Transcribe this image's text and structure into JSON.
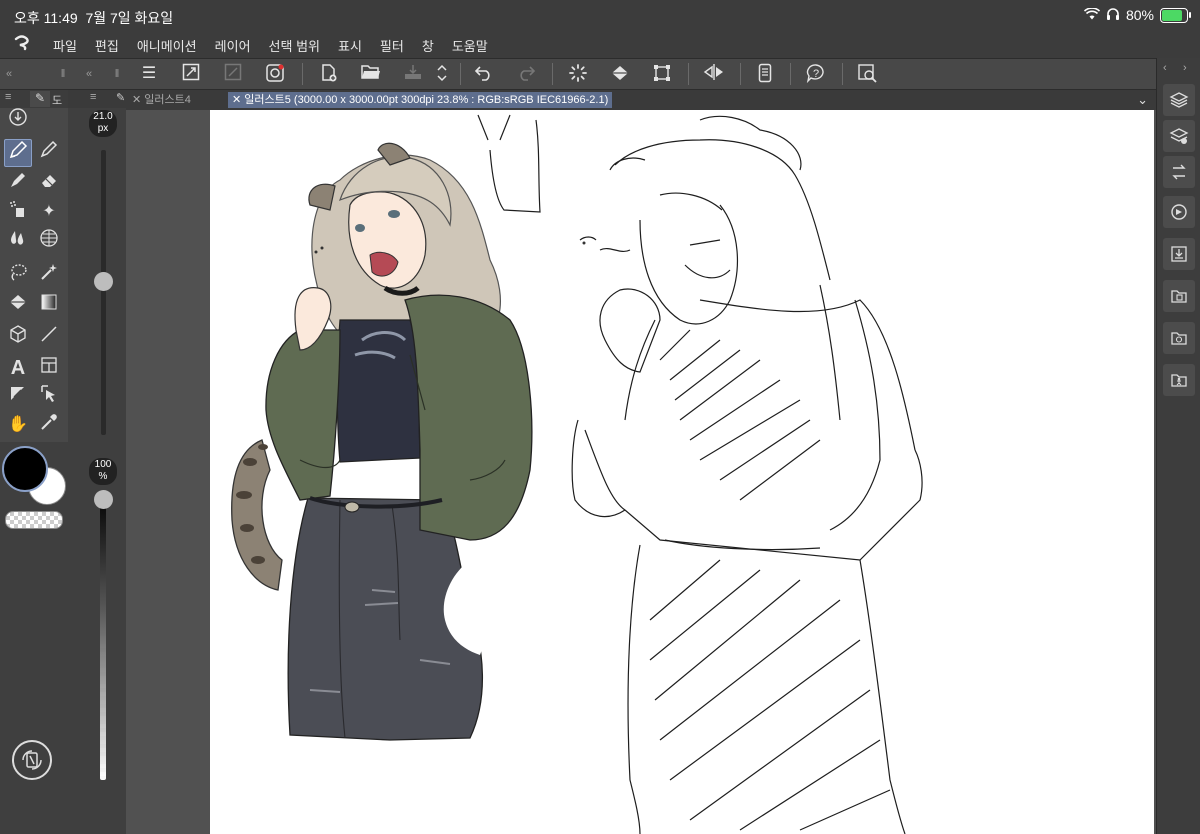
{
  "status": {
    "time": "오후 11:49",
    "date": "7월 7일 화요일",
    "battery": "80%",
    "battery_level": 0.8
  },
  "menu": [
    "파일",
    "편집",
    "애니메이션",
    "레이어",
    "선택 범위",
    "표시",
    "필터",
    "창",
    "도움말"
  ],
  "tabs": [
    {
      "label": "일러스트4",
      "active": false
    },
    {
      "label": "일러스트5 (3000.00 x 3000.00pt 300dpi 23.8% : RGB:sRGB IEC61966-2.1)",
      "active": true
    }
  ],
  "brush": {
    "size": "21.0",
    "size_unit": "px",
    "size_fraction": 0.63,
    "opacity": "100",
    "opacity_unit": "%",
    "opacity_fraction": 1.0
  },
  "colors": {
    "main": "#000000",
    "sub": "#ffffff",
    "accent": "#5e6e8e",
    "jacket": "#5f6b52",
    "pants": "#4b4d55",
    "shirt": "#2e3140",
    "hair": "#cfc6b8"
  },
  "left_panel_tab": "도",
  "icons": {
    "toolbox": [
      "download-circle-icon",
      "pen-icon",
      "pencil-icon",
      "marker-icon",
      "eraser-icon",
      "airbrush-icon",
      "sparkle-icon",
      "blend-icon",
      "mesh-icon",
      "lasso-icon",
      "magic-wand-icon",
      "fill-icon",
      "gradient-icon",
      "3d-box-icon",
      "line-icon",
      "text-icon",
      "panel-icon",
      "correct-line-icon",
      "object-select-icon",
      "hand-icon",
      "eyedropper-icon"
    ],
    "right": [
      "layers-icon",
      "layer-property-icon",
      "history-icon",
      "navigator-icon",
      "import-icon",
      "material-icon",
      "material-2-icon",
      "pose-icon"
    ]
  }
}
